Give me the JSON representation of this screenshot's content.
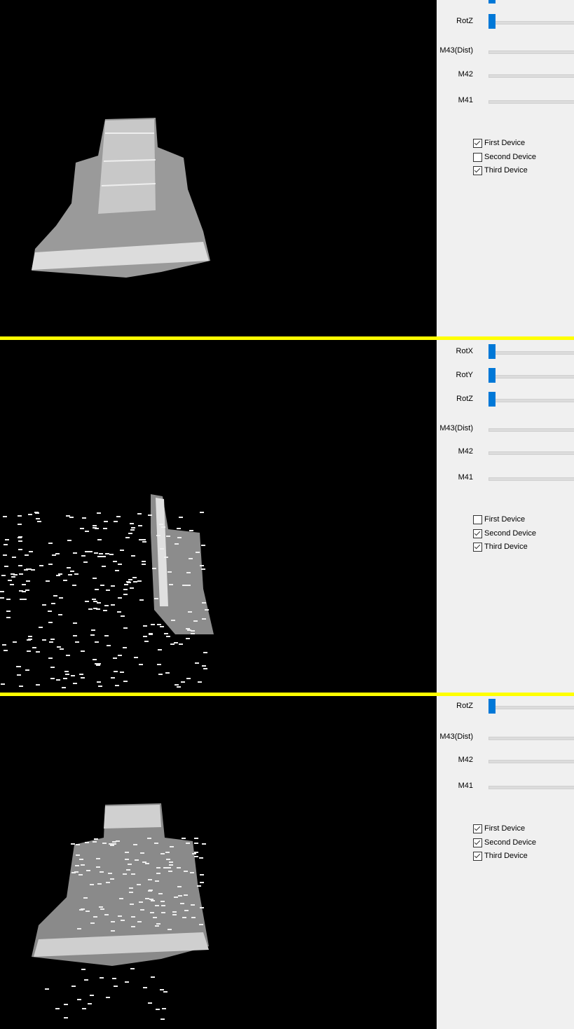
{
  "panels": [
    {
      "view": "first-view",
      "sliders": [
        {
          "label": "",
          "value": 0,
          "partial": true
        },
        {
          "label": "RotZ",
          "value": 0
        },
        {
          "label": "M43(Dist)",
          "value": null
        },
        {
          "label": "M42",
          "value": null
        },
        {
          "label": "M41",
          "value": null
        }
      ],
      "devices": [
        {
          "label": "First Device",
          "checked": true
        },
        {
          "label": "Second Device",
          "checked": false
        },
        {
          "label": "Third Device",
          "checked": true
        }
      ]
    },
    {
      "view": "second-view",
      "sliders": [
        {
          "label": "RotX",
          "value": 0
        },
        {
          "label": "RotY",
          "value": 0
        },
        {
          "label": "RotZ",
          "value": 0
        },
        {
          "label": "M43(Dist)",
          "value": null
        },
        {
          "label": "M42",
          "value": null
        },
        {
          "label": "M41",
          "value": null
        }
      ],
      "devices": [
        {
          "label": "First Device",
          "checked": false
        },
        {
          "label": "Second Device",
          "checked": true
        },
        {
          "label": "Third Device",
          "checked": true
        }
      ]
    },
    {
      "view": "third-view",
      "sliders": [
        {
          "label": "RotZ",
          "value": 0
        },
        {
          "label": "M43(Dist)",
          "value": null
        },
        {
          "label": "M42",
          "value": null
        },
        {
          "label": "M41",
          "value": null
        }
      ],
      "devices": [
        {
          "label": "First Device",
          "checked": true
        },
        {
          "label": "Second Device",
          "checked": true
        },
        {
          "label": "Third Device",
          "checked": true
        }
      ]
    }
  ],
  "colors": {
    "separator": "#ffff00",
    "slider_handle": "#0078d7",
    "panel_bg": "#f0f0f0"
  }
}
